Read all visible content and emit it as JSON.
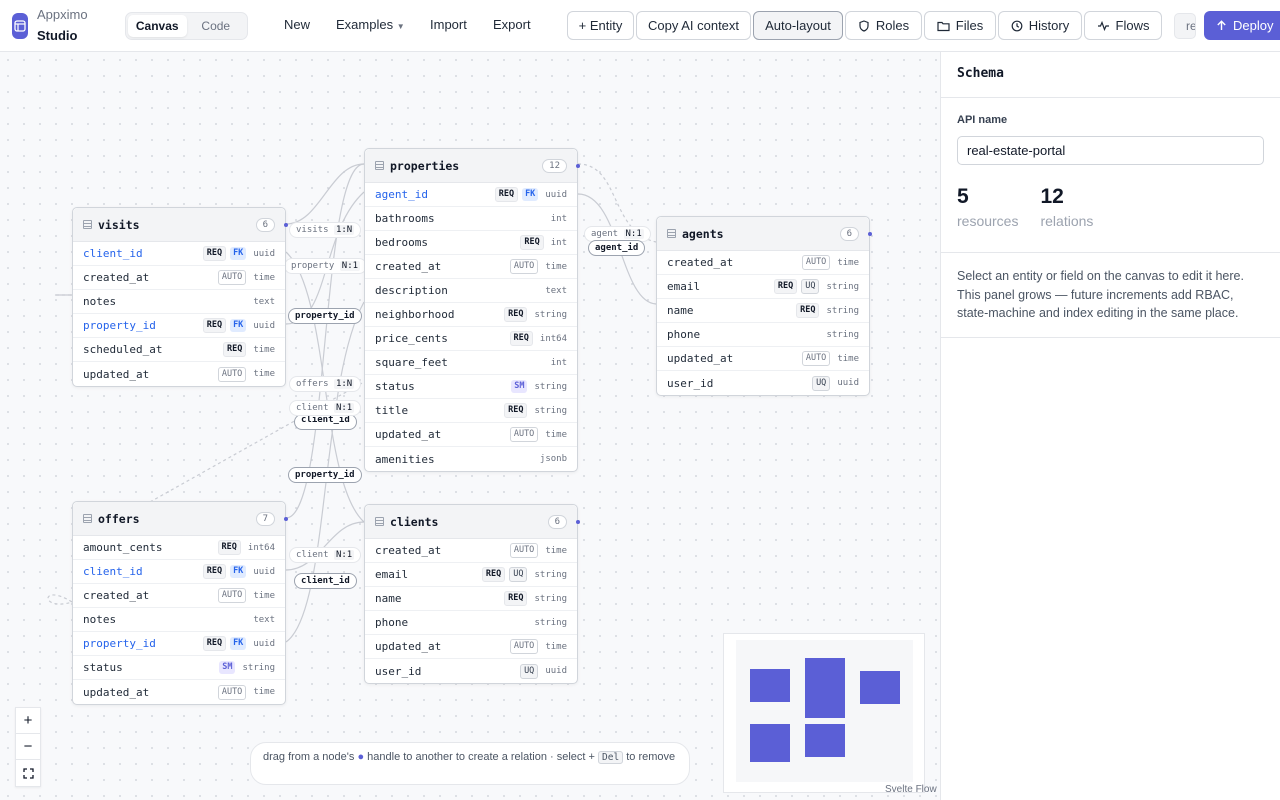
{
  "brand": {
    "line1": "Appximo",
    "line2": "Studio"
  },
  "view_toggle": {
    "canvas": "Canvas",
    "code": "Code"
  },
  "menu": {
    "new": "New",
    "examples": "Examples",
    "import": "Import",
    "export": "Export"
  },
  "toolbar": {
    "entity": "+ Entity",
    "copy_ai": "Copy AI context",
    "autolayout": "Auto-layout",
    "roles": "Roles",
    "files": "Files",
    "history": "History",
    "flows": "Flows",
    "truncated_chip": "re",
    "deploy": "Deploy"
  },
  "entities": {
    "visits": {
      "name": "visits",
      "count": "6",
      "fields": [
        {
          "name": "client_id",
          "fk": true,
          "tags": [
            "REQ",
            "FK"
          ],
          "type": "uuid"
        },
        {
          "name": "created_at",
          "fk": false,
          "tags": [
            "AUTO"
          ],
          "type": "time"
        },
        {
          "name": "notes",
          "fk": false,
          "tags": [],
          "type": "text"
        },
        {
          "name": "property_id",
          "fk": true,
          "tags": [
            "REQ",
            "FK"
          ],
          "type": "uuid"
        },
        {
          "name": "scheduled_at",
          "fk": false,
          "tags": [
            "REQ"
          ],
          "type": "time"
        },
        {
          "name": "updated_at",
          "fk": false,
          "tags": [
            "AUTO"
          ],
          "type": "time"
        }
      ]
    },
    "properties": {
      "name": "properties",
      "count": "12",
      "fields": [
        {
          "name": "agent_id",
          "fk": true,
          "tags": [
            "REQ",
            "FK"
          ],
          "type": "uuid"
        },
        {
          "name": "bathrooms",
          "fk": false,
          "tags": [],
          "type": "int"
        },
        {
          "name": "bedrooms",
          "fk": false,
          "tags": [
            "REQ"
          ],
          "type": "int"
        },
        {
          "name": "created_at",
          "fk": false,
          "tags": [
            "AUTO"
          ],
          "type": "time"
        },
        {
          "name": "description",
          "fk": false,
          "tags": [],
          "type": "text"
        },
        {
          "name": "neighborhood",
          "fk": false,
          "tags": [
            "REQ"
          ],
          "type": "string"
        },
        {
          "name": "price_cents",
          "fk": false,
          "tags": [
            "REQ"
          ],
          "type": "int64"
        },
        {
          "name": "square_feet",
          "fk": false,
          "tags": [],
          "type": "int"
        },
        {
          "name": "status",
          "fk": false,
          "tags": [
            "SM"
          ],
          "type": "string"
        },
        {
          "name": "title",
          "fk": false,
          "tags": [
            "REQ"
          ],
          "type": "string"
        },
        {
          "name": "updated_at",
          "fk": false,
          "tags": [
            "AUTO"
          ],
          "type": "time"
        },
        {
          "name": "amenities",
          "fk": false,
          "tags": [],
          "type": "jsonb"
        }
      ]
    },
    "agents": {
      "name": "agents",
      "count": "6",
      "fields": [
        {
          "name": "created_at",
          "fk": false,
          "tags": [
            "AUTO"
          ],
          "type": "time"
        },
        {
          "name": "email",
          "fk": false,
          "tags": [
            "REQ",
            "UQ"
          ],
          "type": "string"
        },
        {
          "name": "name",
          "fk": false,
          "tags": [
            "REQ"
          ],
          "type": "string"
        },
        {
          "name": "phone",
          "fk": false,
          "tags": [],
          "type": "string"
        },
        {
          "name": "updated_at",
          "fk": false,
          "tags": [
            "AUTO"
          ],
          "type": "time"
        },
        {
          "name": "user_id",
          "fk": false,
          "tags": [
            "UQ"
          ],
          "type": "uuid"
        }
      ]
    },
    "offers": {
      "name": "offers",
      "count": "7",
      "fields": [
        {
          "name": "amount_cents",
          "fk": false,
          "tags": [
            "REQ"
          ],
          "type": "int64"
        },
        {
          "name": "client_id",
          "fk": true,
          "tags": [
            "REQ",
            "FK"
          ],
          "type": "uuid"
        },
        {
          "name": "created_at",
          "fk": false,
          "tags": [
            "AUTO"
          ],
          "type": "time"
        },
        {
          "name": "notes",
          "fk": false,
          "tags": [],
          "type": "text"
        },
        {
          "name": "property_id",
          "fk": true,
          "tags": [
            "REQ",
            "FK"
          ],
          "type": "uuid"
        },
        {
          "name": "status",
          "fk": false,
          "tags": [
            "SM"
          ],
          "type": "string"
        },
        {
          "name": "updated_at",
          "fk": false,
          "tags": [
            "AUTO"
          ],
          "type": "time"
        }
      ]
    },
    "clients": {
      "name": "clients",
      "count": "6",
      "fields": [
        {
          "name": "created_at",
          "fk": false,
          "tags": [
            "AUTO"
          ],
          "type": "time"
        },
        {
          "name": "email",
          "fk": false,
          "tags": [
            "REQ",
            "UQ"
          ],
          "type": "string"
        },
        {
          "name": "name",
          "fk": false,
          "tags": [
            "REQ"
          ],
          "type": "string"
        },
        {
          "name": "phone",
          "fk": false,
          "tags": [],
          "type": "string"
        },
        {
          "name": "updated_at",
          "fk": false,
          "tags": [
            "AUTO"
          ],
          "type": "time"
        },
        {
          "name": "user_id",
          "fk": false,
          "tags": [
            "UQ"
          ],
          "type": "uuid"
        }
      ]
    }
  },
  "edge_labels": {
    "visits": {
      "name": "visits",
      "card": "1:N"
    },
    "property": {
      "name": "property",
      "card": "N:1"
    },
    "offers": {
      "name": "offers",
      "card": "1:N"
    },
    "client1": {
      "name": "client",
      "card": "N:1"
    },
    "client2": {
      "name": "client",
      "card": "N:1"
    },
    "agent": {
      "name": "agent",
      "card": "N:1"
    }
  },
  "fk_labels": {
    "property_id_1": "property_id",
    "client_id_1": "client_id",
    "property_id_2": "property_id",
    "client_id_2": "client_id",
    "agent_id": "agent_id"
  },
  "hint": {
    "prefix": "drag from a node's",
    "dot": "●",
    "mid": "handle to another to create a relation · select +",
    "key": "Del",
    "suffix": "to remove"
  },
  "attribution": "Svelte Flow",
  "panel": {
    "title": "Schema",
    "api_label": "API name",
    "api_value": "real-estate-portal",
    "resources_count": "5",
    "resources_label": "resources",
    "relations_count": "12",
    "relations_label": "relations",
    "note": "Select an entity or field on the canvas to edit it here. This panel grows — future increments add RBAC, state-machine and index editing in the same place."
  },
  "colors": {
    "accent": "#5b5fd6",
    "fk": "#2563eb"
  }
}
